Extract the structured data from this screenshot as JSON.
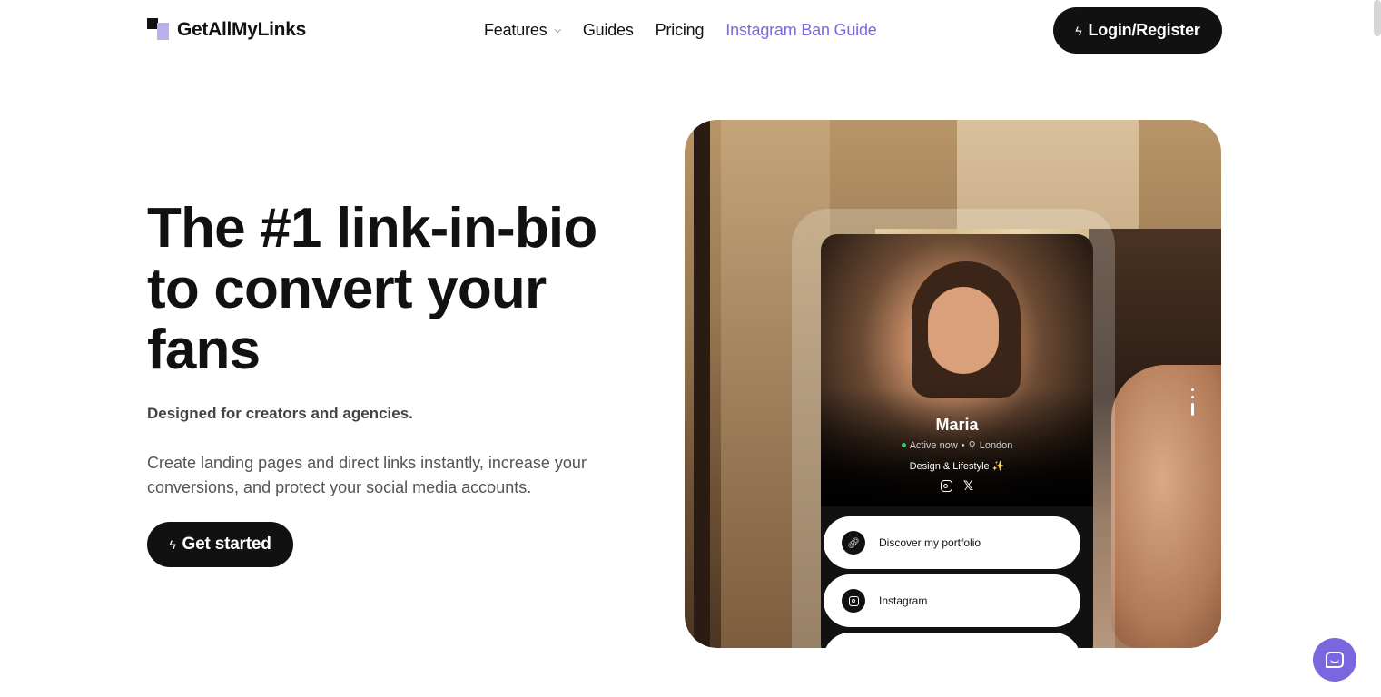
{
  "header": {
    "logo_text": "GetAllMyLinks",
    "nav": {
      "features": "Features",
      "guides": "Guides",
      "pricing": "Pricing",
      "ban_guide": "Instagram Ban Guide"
    },
    "login_label": "Login/Register"
  },
  "hero": {
    "title_line1": "The #1 link-in-bio",
    "title_line2": "to convert your",
    "title_line3": "fans",
    "subtitle": "Designed for creators and agencies.",
    "description": "Create landing pages and direct links instantly, increase your conversions, and protect your social media accounts.",
    "cta_label": "Get started"
  },
  "profile": {
    "name": "Maria",
    "status": "Active now",
    "separator": "•",
    "location": "London",
    "bio": "Design & Lifestyle ✨",
    "links": [
      {
        "label": "Discover my portfolio",
        "icon": "link-icon"
      },
      {
        "label": "Instagram",
        "icon": "instagram-icon"
      }
    ]
  },
  "colors": {
    "accent": "#7c66e0",
    "dark": "#111111",
    "logo_accent": "#b9b0ee"
  }
}
